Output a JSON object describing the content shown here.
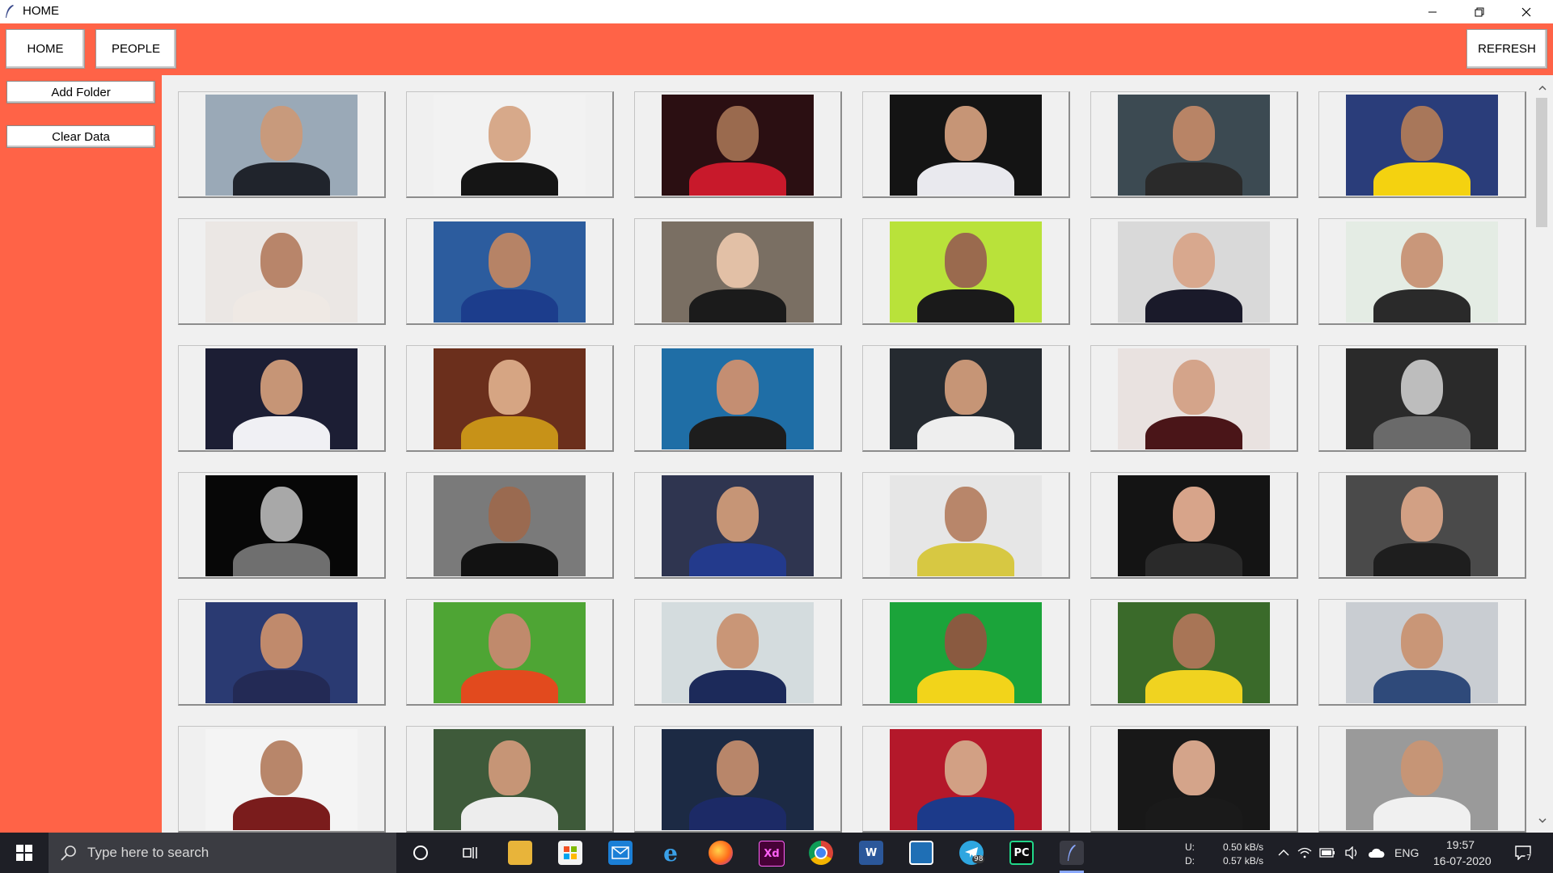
{
  "window": {
    "title": "HOME"
  },
  "toolbar": {
    "home_label": "HOME",
    "people_label": "PEOPLE",
    "refresh_label": "REFRESH"
  },
  "sidebar": {
    "add_folder_label": "Add Folder",
    "clear_data_label": "Clear Data"
  },
  "colors": {
    "accent": "#ff6347",
    "content_bg": "#f0f0f0",
    "taskbar": "#1e1f26"
  },
  "gallery": {
    "columns": 6,
    "rows": 6,
    "photos": [
      {
        "bg": "#9aa9b7",
        "skin": "#c89a7c",
        "shirt": "#20242c"
      },
      {
        "bg": "#f2f2f2",
        "skin": "#d7a98a",
        "shirt": "#151515"
      },
      {
        "bg": "#2b0f12",
        "skin": "#9a6a4e",
        "shirt": "#c8192b"
      },
      {
        "bg": "#141414",
        "skin": "#c69576",
        "shirt": "#e9e9ee"
      },
      {
        "bg": "#3c4a52",
        "skin": "#b88466",
        "shirt": "#2a2a2a"
      },
      {
        "bg": "#2a3d7a",
        "skin": "#a8775a",
        "shirt": "#f4d210"
      },
      {
        "bg": "#ebe7e4",
        "skin": "#b8856a",
        "shirt": "#efe9e4"
      },
      {
        "bg": "#2c5c9e",
        "skin": "#b68366",
        "shirt": "#1c3d8c"
      },
      {
        "bg": "#7a6f63",
        "skin": "#e2c0a6",
        "shirt": "#1b1b1b"
      },
      {
        "bg": "#b9e23a",
        "skin": "#9a6a4e",
        "shirt": "#1a1a1a"
      },
      {
        "bg": "#d9d9d9",
        "skin": "#d8a88e",
        "shirt": "#1a1a2a"
      },
      {
        "bg": "#e4ece4",
        "skin": "#c9977a",
        "shirt": "#2a2a2a"
      },
      {
        "bg": "#1c1e34",
        "skin": "#c69576",
        "shirt": "#f0f0f4"
      },
      {
        "bg": "#6b2f1c",
        "skin": "#d6a583",
        "shirt": "#c79218"
      },
      {
        "bg": "#1f6ea6",
        "skin": "#c48e72",
        "shirt": "#1d1d1d"
      },
      {
        "bg": "#252a30",
        "skin": "#c69576",
        "shirt": "#eeeeee"
      },
      {
        "bg": "#e9e2e0",
        "skin": "#d4a48a",
        "shirt": "#4a1518"
      },
      {
        "bg": "#2a2a2a",
        "skin": "#bdbdbd",
        "shirt": "#6a6a6a"
      },
      {
        "bg": "#070707",
        "skin": "#a8a8a8",
        "shirt": "#6f6f6f"
      },
      {
        "bg": "#7a7a7a",
        "skin": "#9a6a50",
        "shirt": "#121212"
      },
      {
        "bg": "#2f3550",
        "skin": "#c69576",
        "shirt": "#233a8c"
      },
      {
        "bg": "#e6e6e6",
        "skin": "#b8866a",
        "shirt": "#d7c842"
      },
      {
        "bg": "#141414",
        "skin": "#d7a48a",
        "shirt": "#2a2a2a"
      },
      {
        "bg": "#4a4a4a",
        "skin": "#d2a084",
        "shirt": "#1e1e1e"
      },
      {
        "bg": "#2a3a72",
        "skin": "#c08a6c",
        "shirt": "#232a55"
      },
      {
        "bg": "#4ea534",
        "skin": "#c08a6c",
        "shirt": "#e24a1e"
      },
      {
        "bg": "#d4dcde",
        "skin": "#c99677",
        "shirt": "#1c2a5a"
      },
      {
        "bg": "#1ba43a",
        "skin": "#8a5a40",
        "shirt": "#f2d41a"
      },
      {
        "bg": "#3a6a2a",
        "skin": "#a87556",
        "shirt": "#f0d320"
      },
      {
        "bg": "#c9cdd2",
        "skin": "#c99677",
        "shirt": "#2f4a7a"
      },
      {
        "bg": "#f4f4f4",
        "skin": "#b8866a",
        "shirt": "#7a1c1c"
      },
      {
        "bg": "#3e5a3a",
        "skin": "#c69576",
        "shirt": "#ededed"
      },
      {
        "bg": "#1c2a44",
        "skin": "#b8866a",
        "shirt": "#1c2a66"
      },
      {
        "bg": "#b4182a",
        "skin": "#d2a084",
        "shirt": "#1c3a8a"
      },
      {
        "bg": "#181818",
        "skin": "#d4a48a",
        "shirt": "#1a1a1a"
      },
      {
        "bg": "#9a9a9a",
        "skin": "#c69576",
        "shirt": "#f0f0f0"
      }
    ]
  },
  "taskbar": {
    "search_placeholder": "Type here to search",
    "net_up_label": "U:",
    "net_down_label": "D:",
    "net_up": "0.50 kB/s",
    "net_down": "0.57 kB/s",
    "language": "ENG",
    "time": "19:57",
    "date": "16-07-2020",
    "notification_count": "7",
    "telegram_badge": "98",
    "xd_label": "Xd",
    "pycharm_label": "PC",
    "word_label": "W"
  }
}
